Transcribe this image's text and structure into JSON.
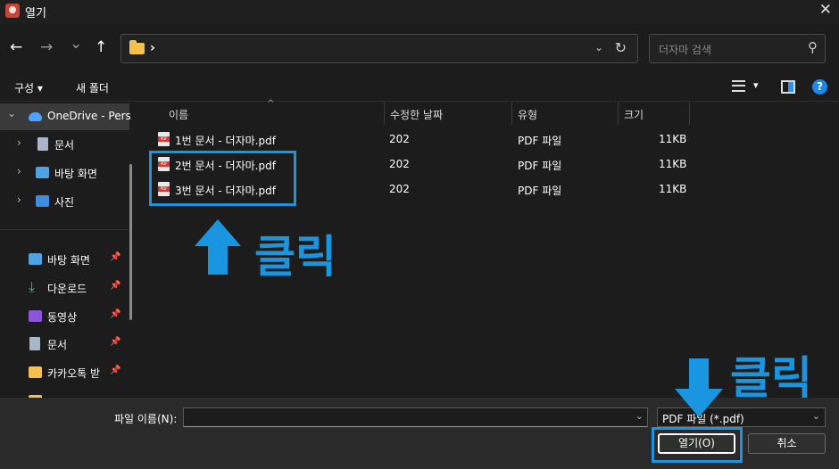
{
  "window": {
    "title": "열기",
    "close_glyph": "✕",
    "icon": "app-icon"
  },
  "nav": {
    "back_glyph": "←",
    "forward_glyph": "→",
    "recent_glyph": "⌄",
    "up_glyph": "↑",
    "crumb_separator": "›",
    "address_dropdown_glyph": "⌄",
    "refresh_glyph": "↻",
    "search_placeholder": "더자마 검색",
    "search_glyph": "⚲"
  },
  "commands": {
    "organize": "구성 ▾",
    "new_folder": "새 폴더",
    "view_dropdown_glyph": "▾",
    "help_glyph": "?"
  },
  "sidebar": {
    "tree": [
      {
        "label": "OneDrive - Pers",
        "icon": "cloud-icon",
        "chevron": "⌄"
      },
      {
        "label": "문서",
        "icon": "document-icon",
        "chevron": "›"
      },
      {
        "label": "바탕 화면",
        "icon": "desktop-icon",
        "chevron": "›"
      },
      {
        "label": "사진",
        "icon": "photo-icon",
        "chevron": "›"
      }
    ],
    "quick_access": [
      {
        "label": "바탕 화면",
        "icon": "desktop-icon",
        "pin": "📌"
      },
      {
        "label": "다운로드",
        "icon": "download-icon",
        "pin": "📌"
      },
      {
        "label": "동영상",
        "icon": "video-icon",
        "pin": "📌"
      },
      {
        "label": "문서",
        "icon": "document-icon",
        "pin": "📌"
      },
      {
        "label": "카카오톡 받",
        "icon": "folder-icon",
        "pin": "📌"
      }
    ],
    "download_glyph": "⤓"
  },
  "file_list": {
    "sort_glyph": "^",
    "columns": [
      "이름",
      "수정한 날짜",
      "유형",
      "크기"
    ],
    "rows": [
      {
        "name": "1번 문서 - 더자마.pdf",
        "modified": "202",
        "type": "PDF 파일",
        "size": "11KB"
      },
      {
        "name": "2번 문서 - 더자마.pdf",
        "modified": "202",
        "type": "PDF 파일",
        "size": "11KB"
      },
      {
        "name": "3번 문서 - 더자마.pdf",
        "modified": "202",
        "type": "PDF 파일",
        "size": "11KB"
      }
    ]
  },
  "annotations": {
    "click_text_1": "클릭",
    "click_text_2": "클릭",
    "accent": "#1a95e0"
  },
  "bottom": {
    "filename_label": "파일 이름(N):",
    "filename_value": "",
    "filename_caret": "⌄",
    "filetype_value": "PDF 파일 (*.pdf)",
    "filetype_caret": "⌄",
    "open_button": "열기(O)",
    "cancel_button": "취소"
  }
}
